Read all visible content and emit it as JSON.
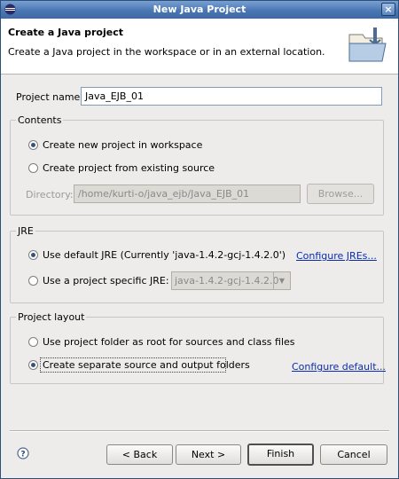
{
  "window": {
    "title": "New Java Project",
    "close_glyph": "×"
  },
  "banner": {
    "title": "Create a Java project",
    "description": "Create a Java project in the workspace or in an external location.",
    "icon": "new-java-project-wizard-icon"
  },
  "project_name": {
    "label": "Project name:",
    "value": "Java_EJB_01"
  },
  "contents": {
    "title": "Contents",
    "option_new": "Create new project in workspace",
    "option_existing": "Create project from existing source",
    "selected": "option_new",
    "directory_label": "Directory:",
    "directory_value": "/home/kurti-o/java_ejb/Java_EJB_01",
    "browse_label": "Browse..."
  },
  "jre": {
    "title": "JRE",
    "option_default": "Use default JRE (Currently 'java-1.4.2-gcj-1.4.2.0')",
    "option_specific": "Use a project specific JRE:",
    "selected": "option_default",
    "configure_link": "Configure JREs...",
    "combo_value": "java-1.4.2-gcj-1.4.2.0"
  },
  "layout": {
    "title": "Project layout",
    "option_root": "Use project folder as root for sources and class files",
    "option_separate": "Create separate source and output folders",
    "selected": "option_separate",
    "configure_link": "Configure default..."
  },
  "buttons": {
    "back": "< Back",
    "next": "Next >",
    "finish": "Finish",
    "cancel": "Cancel"
  },
  "help_icon": "help-icon"
}
